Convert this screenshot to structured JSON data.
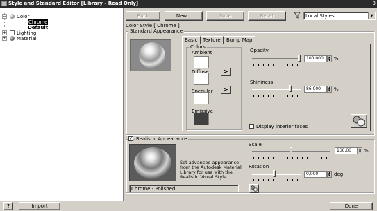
{
  "window": {
    "title": "Style and Standard Editor [Library - Read Only]",
    "corner_text": "3"
  },
  "tree": {
    "items": [
      {
        "label": "Color",
        "expander": "−"
      },
      {
        "label": "Chrome",
        "selected": true
      },
      {
        "label": "Default"
      },
      {
        "label": "Lighting",
        "expander": "+"
      },
      {
        "label": "Material",
        "expander": "+"
      }
    ]
  },
  "toolbar": {
    "back_label": "Back",
    "new_label": "New...",
    "save_label": "Save",
    "reset_label": "Reset",
    "filter_value": "Local Styles"
  },
  "main": {
    "style_caption": "Color Style [ Chrome ]",
    "standard": {
      "legend": "Standard Appearance",
      "tabs": [
        "Basic",
        "Texture",
        "Bump Map"
      ],
      "colors_legend": "Colors",
      "ambient_label": "Ambient",
      "diffuse_label": "Diffuse",
      "specular_label": "Specular",
      "emissive_label": "Emissive",
      "copy_glyph": ">",
      "ambient_color": "#ffffff",
      "diffuse_color": "#ffffff",
      "specular_color": "#ffffff",
      "emissive_color": "#404040",
      "opacity": {
        "label": "Opacity",
        "value": "100,000",
        "unit": "%",
        "level": 1.0
      },
      "shininess": {
        "label": "Shininess",
        "value": "86,000",
        "unit": "%",
        "level": 0.86
      },
      "display_interior_label": "Display interior faces",
      "display_interior_checked": false
    },
    "realistic": {
      "legend": "Realistic Appearance",
      "checked": true,
      "description": "Set advanced appearance from the Autodesk Material Library for use with the Realistic Visual Style.",
      "material_name": "Chrome - Polished",
      "scale": {
        "label": "Scale",
        "value": "100,00",
        "unit": "%"
      },
      "rotation": {
        "label": "Rotation",
        "value": "0,000",
        "unit": "deg"
      }
    }
  },
  "footer": {
    "help_glyph": "?",
    "import_label": "Import",
    "done_label": "Done"
  }
}
